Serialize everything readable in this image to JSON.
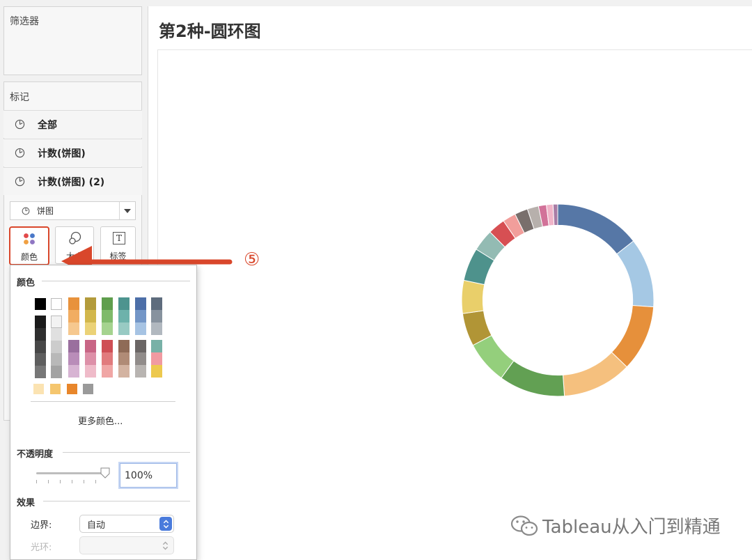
{
  "filters": {
    "title": "筛选器"
  },
  "marks": {
    "title": "标记",
    "rows": [
      {
        "label": "全部"
      },
      {
        "label": "计数(饼图)"
      },
      {
        "label": "计数(饼图) (2)"
      }
    ],
    "mark_type": {
      "value": "饼图"
    },
    "cards": [
      {
        "label": "颜色",
        "icon": "color-dots-icon"
      },
      {
        "label": "大小",
        "icon": "size-circles-icon"
      },
      {
        "label": "标签",
        "icon": "text-label-icon",
        "glyph": "T"
      }
    ]
  },
  "view": {
    "title": "第2种-圆环图"
  },
  "annotation": {
    "step": "⑤",
    "arrow_color": "#d9472b"
  },
  "color_popup": {
    "section_color": "颜色",
    "more_colors": "更多颜色...",
    "section_opacity": "不透明度",
    "opacity_value": "100%",
    "opacity_level": 1.0,
    "section_effects": "效果",
    "border_label": "边界:",
    "border_value": "自动",
    "halo_label": "光环:",
    "halo_value": ""
  },
  "swatches": {
    "top_pair": [
      "#000000",
      "#ffffff"
    ],
    "greys_dark": [
      "#1a1a1a",
      "#2e2e2e",
      "#474747",
      "#5e5e5e",
      "#777777"
    ],
    "greys_light": [
      "#f2f2f2",
      "#e0e0e0",
      "#cccccc",
      "#b8b8b8",
      "#a3a3a3"
    ],
    "row1": [
      [
        "#e8923c",
        "#f1ad62",
        "#f6c88f"
      ],
      [
        "#b39b3b",
        "#d2b74c",
        "#ebd277"
      ],
      [
        "#5f9e4d",
        "#7fba6a",
        "#a5d38f"
      ],
      [
        "#4d948f",
        "#6db2ab",
        "#98cac3"
      ],
      [
        "#4d6fa8",
        "#7396c7",
        "#a6c3e3"
      ],
      [
        "#5e6c7d",
        "#87929e",
        "#b1b8bf"
      ]
    ],
    "row2": [
      [
        "#9a6f9e",
        "#b98db9",
        "#d7b4d3"
      ],
      [
        "#c86585",
        "#dd90a8",
        "#efbbc9"
      ],
      [
        "#cf4f55",
        "#e17b7d",
        "#f0a6a5"
      ],
      [
        "#8f6b57",
        "#b08b76",
        "#d3b3a1"
      ],
      [
        "#6b6665",
        "#918c8a",
        "#b8b4b1"
      ],
      [
        "#78b1a7",
        "#f19aa1",
        "#edc94e"
      ]
    ],
    "singles": [
      "#fbe3b2",
      "#f5c66e",
      "#e8862b",
      "#9a9a9a"
    ]
  },
  "chart_data": {
    "type": "pie",
    "hole": 0.78,
    "slices": [
      {
        "value": 13.0,
        "color": "#5677a6"
      },
      {
        "value": 10.5,
        "color": "#a5c8e4"
      },
      {
        "value": 10.0,
        "color": "#e6903b"
      },
      {
        "value": 10.5,
        "color": "#f5c07e"
      },
      {
        "value": 10.0,
        "color": "#62a053"
      },
      {
        "value": 6.5,
        "color": "#94cf7c"
      },
      {
        "value": 5.0,
        "color": "#b19536"
      },
      {
        "value": 5.0,
        "color": "#e9cf6a"
      },
      {
        "value": 5.0,
        "color": "#4e928c"
      },
      {
        "value": 3.3,
        "color": "#93bbb3"
      },
      {
        "value": 2.6,
        "color": "#d74f53"
      },
      {
        "value": 2.0,
        "color": "#f19e9b"
      },
      {
        "value": 2.0,
        "color": "#796f6c"
      },
      {
        "value": 1.7,
        "color": "#b7b0ac"
      },
      {
        "value": 1.2,
        "color": "#d27299"
      },
      {
        "value": 1.0,
        "color": "#f0b4c8"
      },
      {
        "value": 0.7,
        "color": "#a97ca5"
      }
    ]
  },
  "watermark": {
    "text": "Tableau从入门到精通"
  }
}
